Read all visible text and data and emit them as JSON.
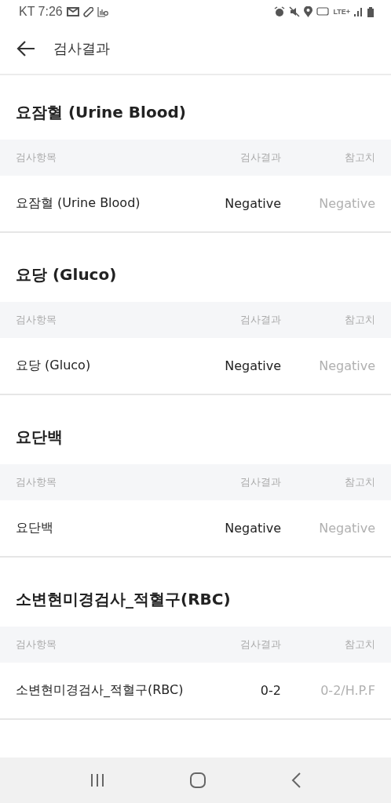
{
  "status_bar": {
    "carrier_time": "KT 7:26",
    "network": "LTE+"
  },
  "app_bar": {
    "title": "검사결과"
  },
  "sections": [
    {
      "title": "요잠혈 (Urine Blood)",
      "columns": [
        "검사항목",
        "검사결과",
        "참고치"
      ],
      "rows": [
        {
          "item": "요잠혈 (Urine Blood)",
          "result": "Negative",
          "reference": "Negative"
        }
      ]
    },
    {
      "title": "요당 (Gluco)",
      "columns": [
        "검사항목",
        "검사결과",
        "참고치"
      ],
      "rows": [
        {
          "item": "요당 (Gluco)",
          "result": "Negative",
          "reference": "Negative"
        }
      ]
    },
    {
      "title": "요단백",
      "columns": [
        "검사항목",
        "검사결과",
        "참고치"
      ],
      "rows": [
        {
          "item": "요단백",
          "result": "Negative",
          "reference": "Negative"
        }
      ]
    },
    {
      "title": "소변현미경검사_적혈구(RBC)",
      "columns": [
        "검사항목",
        "검사결과",
        "참고치"
      ],
      "rows": [
        {
          "item": "소변현미경검사_적혈구(RBC)",
          "result": "0-2",
          "reference": "0-2/H.P.F"
        }
      ]
    }
  ]
}
